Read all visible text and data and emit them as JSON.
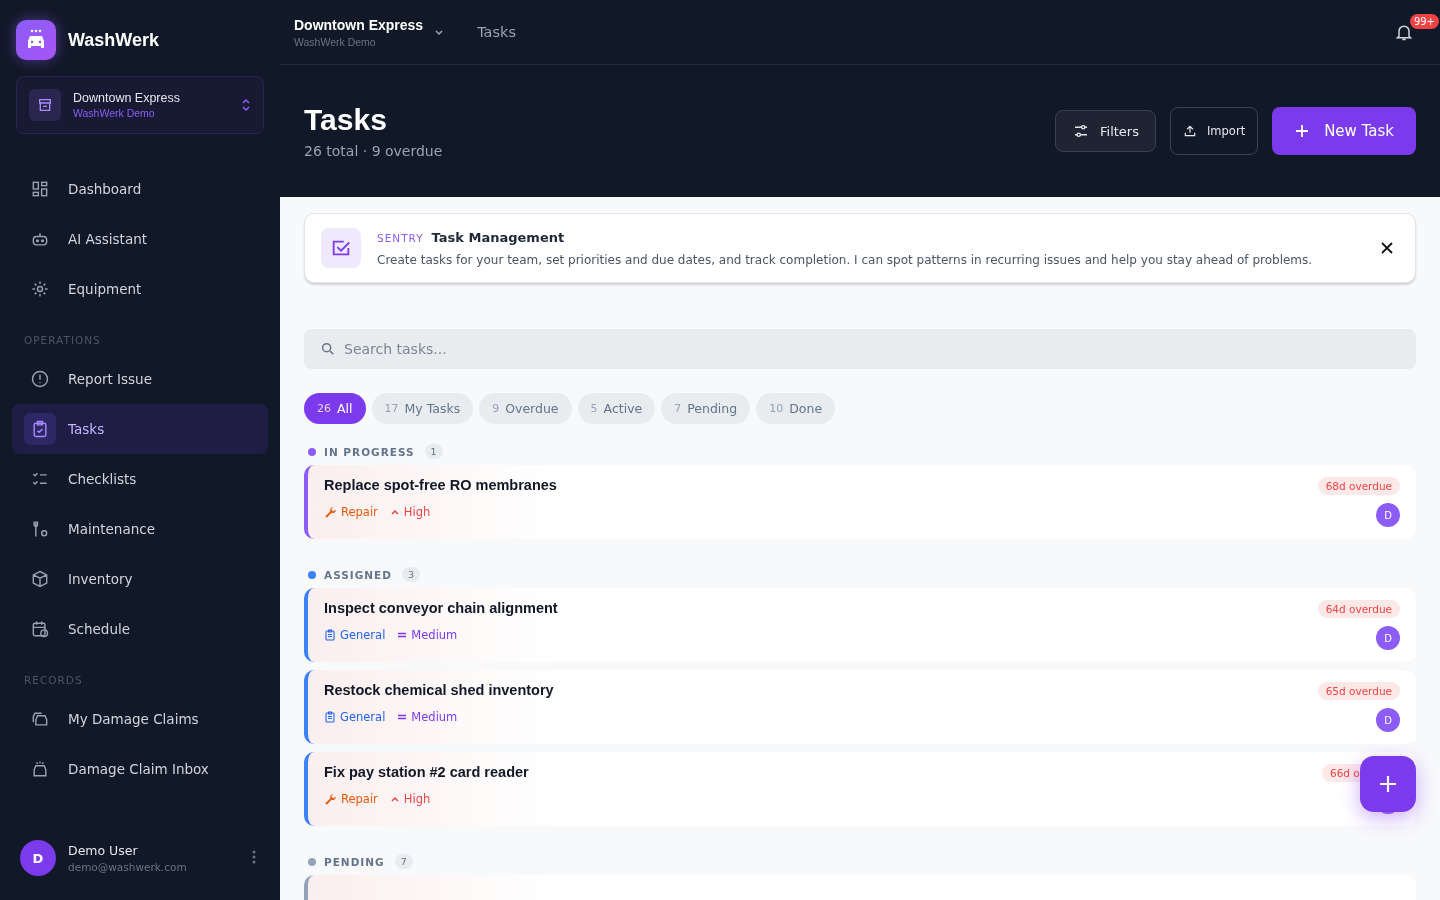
{
  "brand": {
    "name": "WashWerk"
  },
  "location_switcher": {
    "name": "Downtown Express",
    "org": "WashWerk Demo"
  },
  "sidebar": {
    "items": [
      {
        "label": "Dashboard",
        "selected": false
      },
      {
        "label": "AI Assistant",
        "selected": false
      },
      {
        "label": "Equipment",
        "selected": false
      }
    ],
    "sections": [
      {
        "title": "OPERATIONS",
        "items": [
          {
            "label": "Report Issue",
            "selected": false
          },
          {
            "label": "Tasks",
            "selected": true
          },
          {
            "label": "Checklists",
            "selected": false
          },
          {
            "label": "Maintenance",
            "selected": false
          },
          {
            "label": "Inventory",
            "selected": false
          },
          {
            "label": "Schedule",
            "selected": false
          }
        ]
      },
      {
        "title": "RECORDS",
        "items": [
          {
            "label": "My Damage Claims",
            "selected": false
          },
          {
            "label": "Damage Claim Inbox",
            "selected": false
          }
        ]
      }
    ]
  },
  "user": {
    "initial": "D",
    "name": "Demo User",
    "email": "demo@washwerk.com"
  },
  "topbar": {
    "location": "Downtown Express",
    "org": "WashWerk Demo",
    "breadcrumb": "Tasks",
    "notifications": "99+"
  },
  "header": {
    "title": "Tasks",
    "subtitle": "26 total · 9 overdue",
    "buttons": [
      {
        "label": "Filters",
        "kind": "filters"
      },
      {
        "label": "Import",
        "kind": "import"
      },
      {
        "label": "New Task",
        "kind": "primary"
      }
    ]
  },
  "banner": {
    "tag": "SENTRY",
    "title": "Task Management",
    "text": "Create tasks for your team, set priorities and due dates, and track completion. I can spot patterns in recurring issues and help you stay ahead of problems."
  },
  "search": {
    "placeholder": "Search tasks..."
  },
  "filters": [
    {
      "count": "26",
      "label": "All",
      "selected": true
    },
    {
      "count": "17",
      "label": "My Tasks",
      "selected": false
    },
    {
      "count": "9",
      "label": "Overdue",
      "selected": false
    },
    {
      "count": "5",
      "label": "Active",
      "selected": false
    },
    {
      "count": "7",
      "label": "Pending",
      "selected": false
    },
    {
      "count": "10",
      "label": "Done",
      "selected": false
    }
  ],
  "groups": [
    {
      "title": "IN PROGRESS",
      "count": "1",
      "color": "#8b5cf6",
      "tasks": [
        {
          "title": "Replace spot-free RO membranes",
          "category": {
            "label": "Repair",
            "kind": "repair"
          },
          "priority": {
            "label": "High",
            "kind": "high"
          },
          "due": "68d overdue",
          "assignee": "D"
        }
      ]
    },
    {
      "title": "ASSIGNED",
      "count": "3",
      "color": "#3b82f6",
      "tasks": [
        {
          "title": "Inspect conveyor chain alignment",
          "category": {
            "label": "General",
            "kind": "general"
          },
          "priority": {
            "label": "Medium",
            "kind": "medium"
          },
          "due": "64d overdue",
          "assignee": "D"
        },
        {
          "title": "Restock chemical shed inventory",
          "category": {
            "label": "General",
            "kind": "general"
          },
          "priority": {
            "label": "Medium",
            "kind": "medium"
          },
          "due": "65d overdue",
          "assignee": "D"
        },
        {
          "title": "Fix pay station #2 card reader",
          "category": {
            "label": "Repair",
            "kind": "repair"
          },
          "priority": {
            "label": "High",
            "kind": "high"
          },
          "due": "66d o"
        }
      ]
    },
    {
      "title": "PENDING",
      "count": "7",
      "color": "#94a3b8"
    }
  ]
}
